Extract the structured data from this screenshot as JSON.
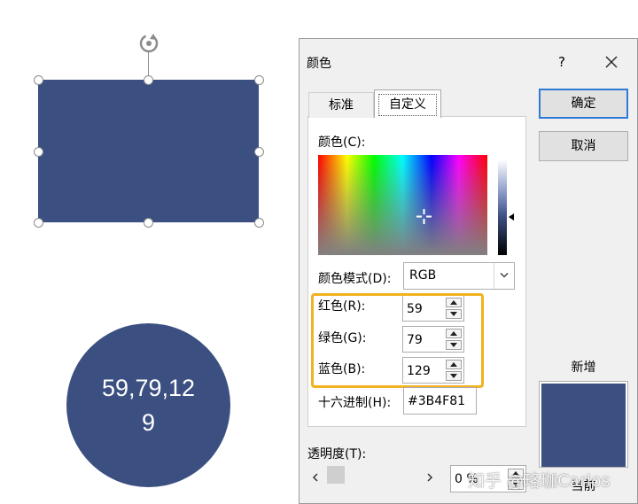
{
  "canvas": {
    "shape_color": "#3B4F81",
    "circle_text": "59,79,129"
  },
  "dialog": {
    "title": "颜色",
    "help_label": "?",
    "tabs": [
      {
        "label": "标准",
        "selected": false
      },
      {
        "label": "自定义",
        "selected": true
      }
    ],
    "colors_label": "颜色(C):",
    "color_model_label": "颜色模式(D):",
    "color_model_value": "RGB",
    "red_label": "红色(R):",
    "red_value": "59",
    "green_label": "绿色(G):",
    "green_value": "79",
    "blue_label": "蓝色(B):",
    "blue_value": "129",
    "hex_label": "十六进制(H):",
    "hex_value": "#3B4F81",
    "transparency_label": "透明度(T):",
    "transparency_value": "0 %",
    "ok_label": "确定",
    "cancel_label": "取消",
    "new_label": "新增",
    "current_label": "当前",
    "highlight_color": "#f2b21f",
    "accent_color": "#2f7ad6"
  },
  "watermark": "知乎 @珞珈Carlos"
}
